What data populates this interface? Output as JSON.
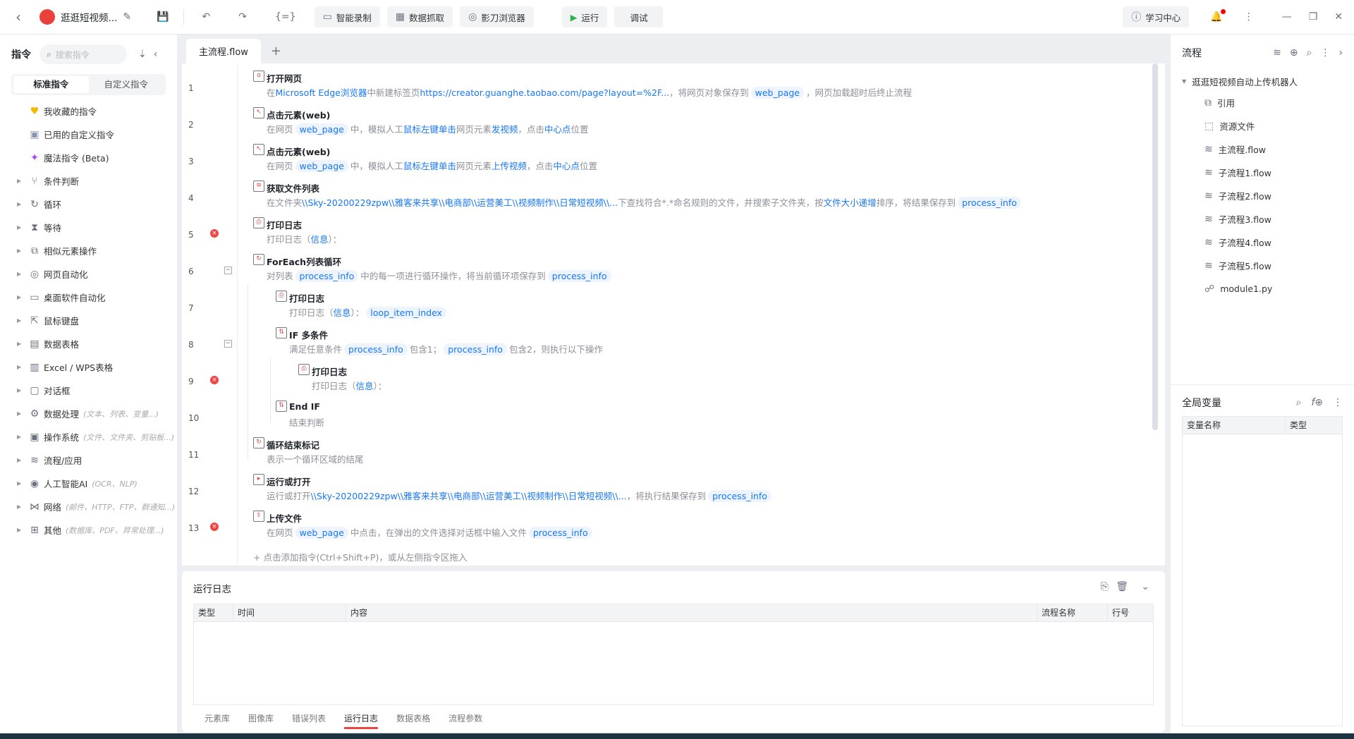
{
  "topbar": {
    "back": "‹",
    "app_title": "逛逛短视频...",
    "record": "智能录制",
    "grab": "数据抓取",
    "browser": "影刀浏览器",
    "run": "运行",
    "debug": "调试",
    "learn": "学习中心"
  },
  "sidebar": {
    "title": "指令",
    "search_placeholder": "搜索指令",
    "tab_standard": "标准指令",
    "tab_custom": "自定义指令",
    "fixed": [
      {
        "label": "我收藏的指令",
        "icon": "♥",
        "color": "#f5b800"
      },
      {
        "label": "已用的自定义指令",
        "icon": "▣",
        "color": "#8a93b0"
      },
      {
        "label": "魔法指令 (Beta)",
        "icon": "✦",
        "color": "#b041f0"
      }
    ],
    "groups": [
      {
        "label": "条件判断",
        "icon": "⑂",
        "hint": ""
      },
      {
        "label": "循环",
        "icon": "↻",
        "hint": ""
      },
      {
        "label": "等待",
        "icon": "⧗",
        "hint": ""
      },
      {
        "label": "相似元素操作",
        "icon": "⧉",
        "hint": ""
      },
      {
        "label": "网页自动化",
        "icon": "◎",
        "hint": ""
      },
      {
        "label": "桌面软件自动化",
        "icon": "▭",
        "hint": ""
      },
      {
        "label": "鼠标键盘",
        "icon": "⇱",
        "hint": ""
      },
      {
        "label": "数据表格",
        "icon": "▤",
        "hint": ""
      },
      {
        "label": "Excel / WPS表格",
        "icon": "▥",
        "hint": ""
      },
      {
        "label": "对话框",
        "icon": "▢",
        "hint": ""
      },
      {
        "label": "数据处理",
        "icon": "⚙",
        "hint": "(文本、列表、变量...)"
      },
      {
        "label": "操作系统",
        "icon": "▣",
        "hint": "(文件、文件夹、剪贴板...)"
      },
      {
        "label": "流程/应用",
        "icon": "≋",
        "hint": ""
      },
      {
        "label": "人工智能AI",
        "icon": "◉",
        "hint": "(OCR、NLP)"
      },
      {
        "label": "网络",
        "icon": "⋈",
        "hint": "(邮件、HTTP、FTP、群通知...)"
      },
      {
        "label": "其他",
        "icon": "⊞",
        "hint": "(数据库、PDF、异常处理...)"
      }
    ]
  },
  "editor": {
    "tab": "主流程.flow",
    "add_tab": "+",
    "add_hint": "点击添加指令(Ctrl+Shift+P)，或从左侧指令区拖入",
    "steps": [
      {
        "n": "1",
        "lvl": 0,
        "icon": "o",
        "title": "打开网页",
        "desc": [
          [
            "t",
            "在"
          ],
          [
            "l",
            "Microsoft Edge浏览器"
          ],
          [
            "t",
            "中新建标签页"
          ],
          [
            "l",
            "https://creator.guanghe.taobao.com/page?layout=%2F..."
          ],
          [
            "t",
            "，将网页对象保存到"
          ],
          [
            "v",
            "web_page"
          ],
          [
            "t",
            "，网页加载超时后终止流程"
          ]
        ]
      },
      {
        "n": "2",
        "lvl": 0,
        "icon": "↖",
        "title": "点击元素(web)",
        "desc": [
          [
            "t",
            "在网页"
          ],
          [
            "v",
            "web_page"
          ],
          [
            "t",
            "中，模拟人工"
          ],
          [
            "l",
            "鼠标左键单击"
          ],
          [
            "t",
            "网页元素"
          ],
          [
            "l",
            "发视频"
          ],
          [
            "t",
            "，点击"
          ],
          [
            "l",
            "中心点"
          ],
          [
            "t",
            "位置"
          ]
        ]
      },
      {
        "n": "3",
        "lvl": 0,
        "icon": "↖",
        "title": "点击元素(web)",
        "desc": [
          [
            "t",
            "在网页"
          ],
          [
            "v",
            "web_page"
          ],
          [
            "t",
            "中，模拟人工"
          ],
          [
            "l",
            "鼠标左键单击"
          ],
          [
            "t",
            "网页元素"
          ],
          [
            "l",
            "上传视频"
          ],
          [
            "t",
            "，点击"
          ],
          [
            "l",
            "中心点"
          ],
          [
            "t",
            "位置"
          ]
        ]
      },
      {
        "n": "4",
        "lvl": 0,
        "icon": "≡",
        "title": "获取文件列表",
        "desc": [
          [
            "t",
            "在文件夹"
          ],
          [
            "l",
            "\\\\Sky-20200229zpw\\\\雅客来共享\\\\电商部\\\\运营美工\\\\视频制作\\\\日常短视频\\\\..."
          ],
          [
            "t",
            "下查找符合*.*命名规则的文件，并搜索子文件夹，按"
          ],
          [
            "l",
            "文件大小递增"
          ],
          [
            "t",
            "排序，将结果保存到"
          ],
          [
            "v",
            "process_info"
          ]
        ]
      },
      {
        "n": "5",
        "lvl": 0,
        "icon": "⎙",
        "err": true,
        "title": "打印日志",
        "desc": [
          [
            "t",
            "打印日志（"
          ],
          [
            "l",
            "信息"
          ],
          [
            "t",
            "）："
          ]
        ]
      },
      {
        "n": "6",
        "lvl": 0,
        "icon": "↻",
        "col": true,
        "title": "ForEach列表循环",
        "desc": [
          [
            "t",
            "对列表"
          ],
          [
            "v",
            "process_info"
          ],
          [
            "t",
            "中的每一项进行循环操作，将当前循环项保存到"
          ],
          [
            "v",
            "process_info"
          ]
        ]
      },
      {
        "n": "7",
        "lvl": 1,
        "icon": "⎙",
        "title": "打印日志",
        "desc": [
          [
            "t",
            "打印日志（"
          ],
          [
            "l",
            "信息"
          ],
          [
            "t",
            "）："
          ],
          [
            "v",
            "loop_item_index"
          ]
        ]
      },
      {
        "n": "8",
        "lvl": 1,
        "icon": "⇅",
        "col": true,
        "title": "IF 多条件",
        "desc": [
          [
            "t",
            "满足任意条件"
          ],
          [
            "v",
            "process_info"
          ],
          [
            "t",
            "包含1；"
          ],
          [
            "v",
            "process_info"
          ],
          [
            "t",
            "包含2，则执行以下操作"
          ]
        ]
      },
      {
        "n": "9",
        "lvl": 2,
        "icon": "⎙",
        "err": true,
        "title": "打印日志",
        "desc": [
          [
            "t",
            "打印日志（"
          ],
          [
            "l",
            "信息"
          ],
          [
            "t",
            "）："
          ]
        ]
      },
      {
        "n": "10",
        "lvl": 1,
        "icon": "⇅",
        "title": "End IF",
        "desc": [
          [
            "t",
            "结束判断"
          ]
        ]
      },
      {
        "n": "11",
        "lvl": 0,
        "icon": "↻",
        "title": "循环结束标记",
        "desc": [
          [
            "t",
            "表示一个循环区域的结尾"
          ]
        ]
      },
      {
        "n": "12",
        "lvl": 0,
        "icon": "▸",
        "title": "运行或打开",
        "desc": [
          [
            "t",
            "运行或打开"
          ],
          [
            "l",
            "\\\\Sky-20200229zpw\\\\雅客来共享\\\\电商部\\\\运营美工\\\\视频制作\\\\日常短视频\\\\..."
          ],
          [
            "t",
            "，将执行结果保存到"
          ],
          [
            "v",
            "process_info"
          ]
        ]
      },
      {
        "n": "13",
        "lvl": 0,
        "icon": "⇪",
        "err": true,
        "title": "上传文件",
        "desc": [
          [
            "t",
            "在网页"
          ],
          [
            "v",
            "web_page"
          ],
          [
            "t",
            "中点击，在弹出的文件选择对话框中输入文件"
          ],
          [
            "v",
            "process_info"
          ]
        ]
      }
    ]
  },
  "log": {
    "title": "运行日志",
    "columns": [
      "类型",
      "时间",
      "内容",
      "流程名称",
      "行号"
    ],
    "tabs": [
      "元素库",
      "图像库",
      "错误列表",
      "运行日志",
      "数据表格",
      "流程参数"
    ],
    "active_tab": "运行日志"
  },
  "right": {
    "title": "流程",
    "root": "逛逛短视频自动上传机器人",
    "items": [
      {
        "label": "引用",
        "icon": "⧉"
      },
      {
        "label": "资源文件",
        "icon": "⬚"
      },
      {
        "label": "主流程.flow",
        "icon": "≋"
      },
      {
        "label": "子流程1.flow",
        "icon": "≋"
      },
      {
        "label": "子流程2.flow",
        "icon": "≋"
      },
      {
        "label": "子流程3.flow",
        "icon": "≋"
      },
      {
        "label": "子流程4.flow",
        "icon": "≋"
      },
      {
        "label": "子流程5.flow",
        "icon": "≋"
      },
      {
        "label": "module1.py",
        "icon": "☍"
      }
    ],
    "vars_title": "全局变量",
    "var_columns": [
      "变量名称",
      "类型"
    ]
  }
}
